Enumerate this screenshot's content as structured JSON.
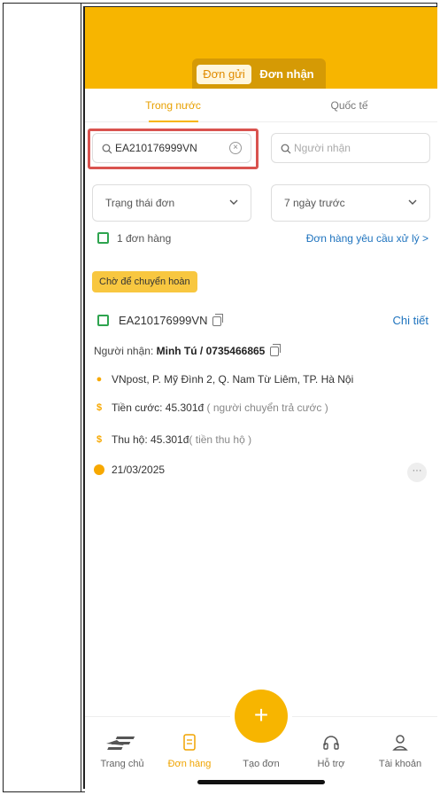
{
  "header": {
    "segments": {
      "active": "Đơn gửi",
      "inactive": "Đơn nhận"
    }
  },
  "subtabs": {
    "domestic": "Trong nước",
    "international": "Quốc tế"
  },
  "search": {
    "tracking_value": "EA210176999VN",
    "recipient_placeholder": "Người nhận"
  },
  "filters": {
    "status": "Trạng thái đơn",
    "period": "7 ngày trước"
  },
  "summary": {
    "count": "1 đơn hàng",
    "request_link": "Đơn hàng yêu cầu xử lý >"
  },
  "order": {
    "status_badge": "Chờ để chuyển hoàn",
    "tracking": "EA210176999VN",
    "detail_link": "Chi tiết",
    "recipient_label": "Người nhận: ",
    "recipient_value": "Minh Tú / 0735466865",
    "address": "VNpost, P. Mỹ Đình 2, Q. Nam Từ Liêm, TP. Hà Nội",
    "freight_label": "Tiền cước: 45.301đ",
    "freight_note": " ( người chuyển trả cước )",
    "cod_label": "Thu hộ: 45.301đ",
    "cod_note": "( tiền thu hộ )",
    "date": "21/03/2025",
    "more": "···"
  },
  "nav": {
    "home": "Trang chủ",
    "orders": "Đơn hàng",
    "create": "Tạo đơn",
    "support": "Hỗ trợ",
    "account": "Tài khoản",
    "create_icon": "+"
  },
  "colors": {
    "brand": "#f7b500",
    "link": "#1e73be",
    "check": "#2ea44f",
    "highlight": "#d9534f"
  }
}
